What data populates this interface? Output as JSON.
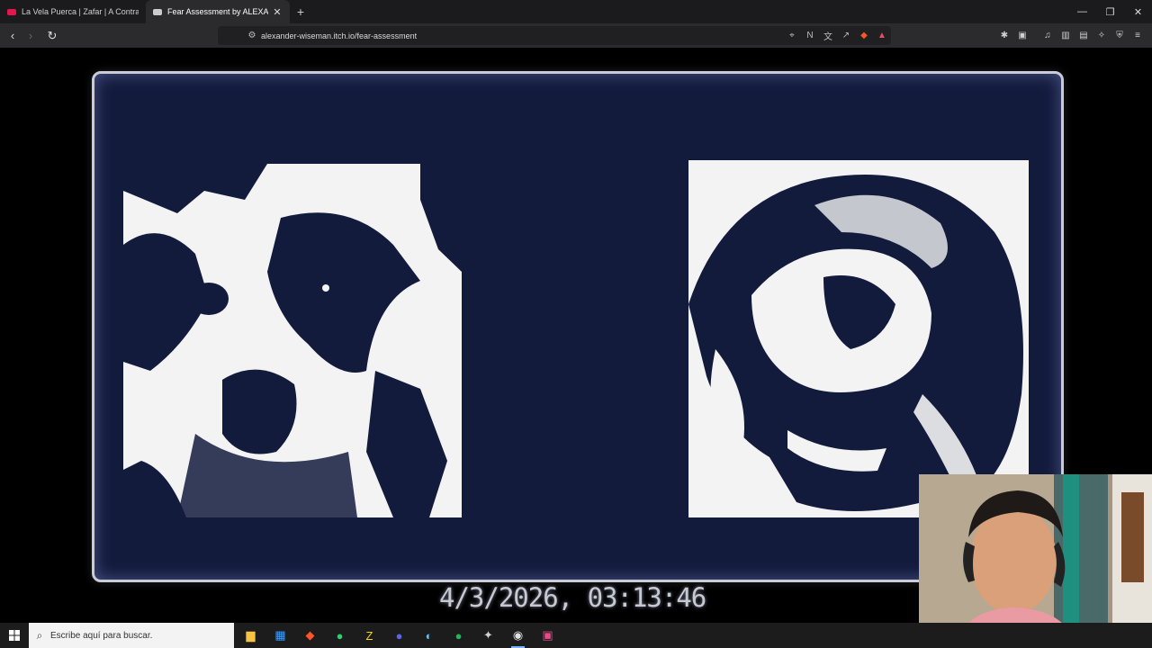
{
  "browser": {
    "tabs": [
      {
        "title": "La Vela Puerca | Zafar | A Contraluz ·",
        "favicon_color": "#e4174c",
        "active": false
      },
      {
        "title": "Fear Assessment by ALEXANDER",
        "favicon_color": "#cccccc",
        "active": true
      }
    ],
    "new_tab_label": "+",
    "url": "alexander-wiseman.itch.io/fear-assessment",
    "window_controls": [
      "—",
      "❐",
      "✕"
    ]
  },
  "game": {
    "timestamp": "4/3/2026, 03:13:46",
    "panels": [
      {
        "subject": "dog-face-image"
      },
      {
        "subject": "fetus-ultrasound-image"
      }
    ],
    "colors": {
      "screen": "#131b3d",
      "frame": "#c9ccd6",
      "text": "#c7c9d2"
    }
  },
  "taskbar": {
    "search_placeholder": "Escribe aquí para buscar.",
    "apps": [
      {
        "name": "file-explorer",
        "glyph": "▆",
        "color": "#f6c343"
      },
      {
        "name": "store",
        "glyph": "▦",
        "color": "#3fa0ff"
      },
      {
        "name": "brave",
        "glyph": "◆",
        "color": "#fb542b"
      },
      {
        "name": "whatsapp",
        "glyph": "●",
        "color": "#25d366"
      },
      {
        "name": "zoom-or-app",
        "glyph": "Z",
        "color": "#f5d90a"
      },
      {
        "name": "discord",
        "glyph": "●",
        "color": "#5865f2"
      },
      {
        "name": "steam",
        "glyph": "◐",
        "color": "#66c0f4"
      },
      {
        "name": "spotify",
        "glyph": "●",
        "color": "#1db954"
      },
      {
        "name": "game-app",
        "glyph": "✦",
        "color": "#d0d0d0"
      },
      {
        "name": "obs",
        "glyph": "◉",
        "color": "#e0e0e0",
        "active": true
      },
      {
        "name": "capture-app",
        "glyph": "▣",
        "color": "#e84a8a"
      }
    ]
  }
}
